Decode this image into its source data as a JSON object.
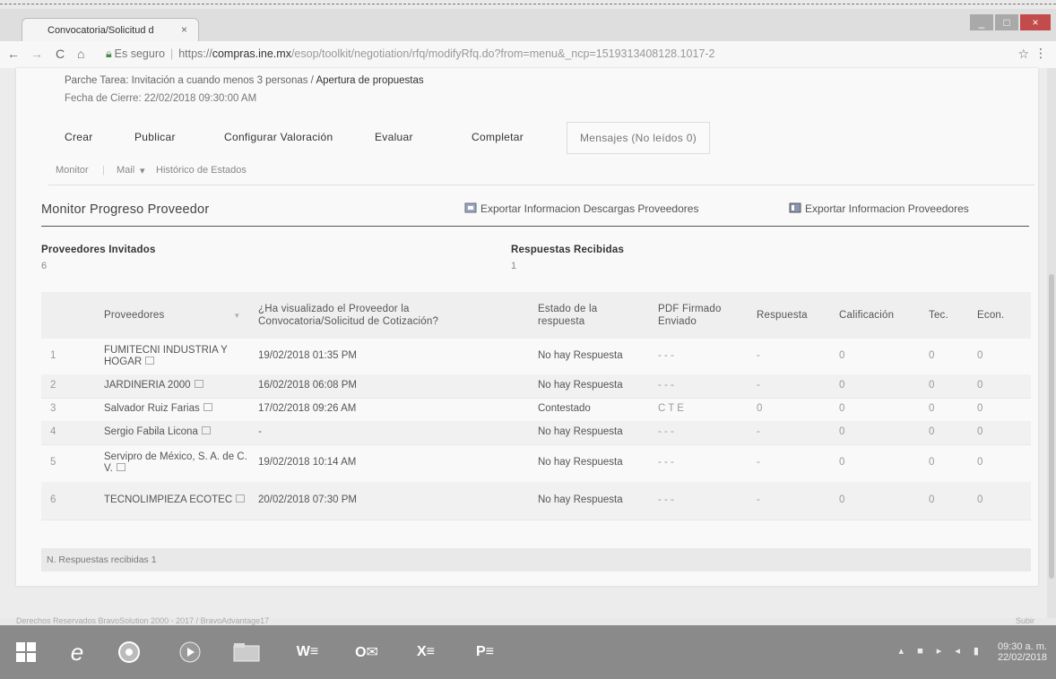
{
  "browser": {
    "tab_title": "Convocatoria/Solicitud d",
    "tab_close": "×",
    "secure_label": "Es seguro",
    "url_scheme": "https://",
    "url_host": "compras.ine.mx",
    "url_path": "/esop/toolkit/negotiation/rfq/modifyRfq.do?from=menu&_ncp=1519313408128.1017-2",
    "back": "←",
    "forward": "→",
    "reload": "C",
    "home": "⌂",
    "bookmark": "☆",
    "menu": "⋮",
    "win_min": "_",
    "win_max": "□",
    "win_close": "×"
  },
  "header": {
    "task_prefix": "Parche Tarea: Invitación a cuando menos 3 personas /",
    "task_stage": "Apertura de propuestas",
    "close_date": "Fecha de Cierre: 22/02/2018 09:30:00 AM"
  },
  "actions": {
    "crear": "Crear",
    "publicar": "Publicar",
    "configurar": "Configurar Valoración",
    "evaluar": "Evaluar",
    "completar": "Completar",
    "mensajes": "Mensajes (No leídos 0)"
  },
  "subnav": {
    "monitor": "Monitor",
    "mail": "Mail",
    "mail_arrow": "▾",
    "historico": "Histórico de Estados"
  },
  "section": {
    "title": "Monitor Progreso Proveedor",
    "export_downloads": "Exportar Informacion Descargas Proveedores",
    "export_suppliers": "Exportar Informacion Proveedores"
  },
  "stats": {
    "invited_label": "Proveedores Invitados",
    "invited_value": "6",
    "received_label": "Respuestas Recibidas",
    "received_value": "1"
  },
  "table": {
    "headers": {
      "proveedores": "Proveedores",
      "visualizado": "¿Ha visualizado el Proveedor la Convocatoria/Solicitud de Cotización?",
      "estado": "Estado de la respuesta",
      "pdf": "PDF Firmado Enviado",
      "respuesta": "Respuesta",
      "calificacion": "Calificación",
      "tec": "Tec.",
      "econ": "Econ."
    },
    "sort_icon": "▾",
    "rows": [
      {
        "n": "1",
        "proveedor": "FUMITECNI INDUSTRIA Y HOGAR",
        "visto": "19/02/2018 01:35 PM",
        "estado": "No hay Respuesta",
        "pdf": "- - -",
        "respuesta": "-",
        "calificacion": "0",
        "tec": "0",
        "econ": "0"
      },
      {
        "n": "2",
        "proveedor": "JARDINERIA 2000",
        "visto": "16/02/2018 06:08 PM",
        "estado": "No hay Respuesta",
        "pdf": "- - -",
        "respuesta": "-",
        "calificacion": "0",
        "tec": "0",
        "econ": "0"
      },
      {
        "n": "3",
        "proveedor": "Salvador Ruiz Farias",
        "visto": "17/02/2018 09:26 AM",
        "estado": "Contestado",
        "pdf": "C T E",
        "respuesta": "0",
        "calificacion": "0",
        "tec": "0",
        "econ": "0"
      },
      {
        "n": "4",
        "proveedor": "Sergio Fabila Licona",
        "visto": "-",
        "estado": "No hay Respuesta",
        "pdf": "- - -",
        "respuesta": "-",
        "calificacion": "0",
        "tec": "0",
        "econ": "0"
      },
      {
        "n": "5",
        "proveedor": "Servipro de México, S. A. de C. V.",
        "visto": "19/02/2018 10:14 AM",
        "estado": "No hay Respuesta",
        "pdf": "- - -",
        "respuesta": "-",
        "calificacion": "0",
        "tec": "0",
        "econ": "0"
      },
      {
        "n": "6",
        "proveedor": "TECNOLIMPIEZA ECOTEC",
        "visto": "20/02/2018 07:30 PM",
        "estado": "No hay Respuesta",
        "pdf": "- - -",
        "respuesta": "-",
        "calificacion": "0",
        "tec": "0",
        "econ": "0"
      }
    ],
    "footer": "N. Respuestas recibidas 1"
  },
  "page_footer": {
    "copyright": "Derechos Reservados BravoSolution 2000 - 2017 / BravoAdvantage17",
    "up": "Subir"
  },
  "taskbar": {
    "time": "09:30 a. m.",
    "date": "22/02/2018"
  },
  "colors": {
    "taskbar": "#8a8a8a",
    "accent_close": "#c34b4b",
    "secure_lock": "#4a8a4a"
  }
}
